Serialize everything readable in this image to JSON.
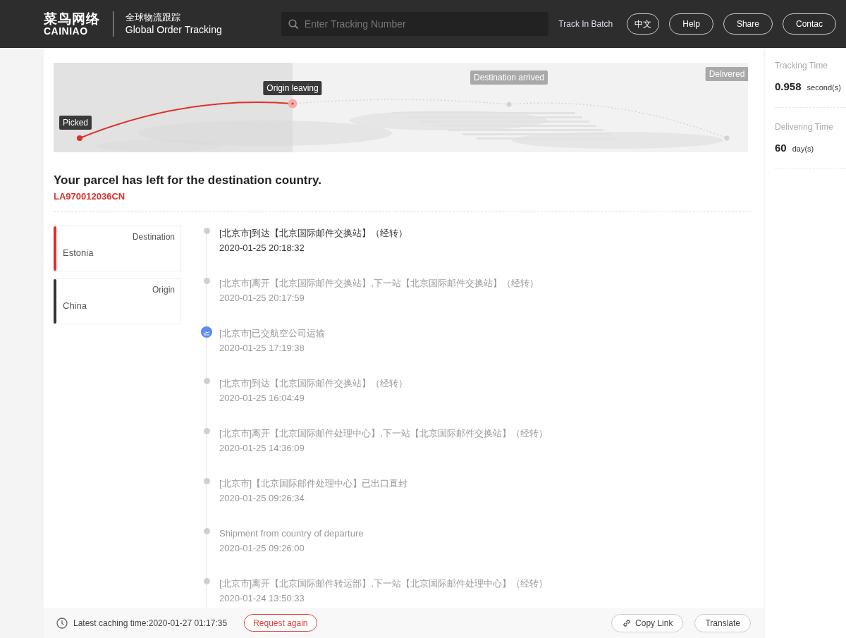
{
  "header": {
    "logo_cn": "菜鸟网络",
    "logo_en": "CAINIAO",
    "subtitle_cn": "全球物流跟踪",
    "subtitle_en": "Global Order Tracking",
    "search": {
      "placeholder": "Enter Tracking Number"
    },
    "batch_link": "Track In Batch",
    "buttons": [
      "中文",
      "Help",
      "Share",
      "Contac"
    ]
  },
  "route": {
    "milestones": [
      {
        "label": "Picked",
        "reached": true
      },
      {
        "label": "Origin leaving",
        "reached": true
      },
      {
        "label": "Destination arrived",
        "reached": false
      },
      {
        "label": "Delivered",
        "reached": false
      }
    ]
  },
  "status": {
    "title": "Your parcel has left for the destination country.",
    "tracking_number": "LA970012036CN"
  },
  "locations": [
    {
      "label": "Destination",
      "country": "Estonia",
      "color": "#e02d2d"
    },
    {
      "label": "Origin",
      "country": "China",
      "color": "#333333"
    }
  ],
  "events": [
    {
      "kind": "dot",
      "latest": true,
      "text": "[北京市]到达【北京国际邮件交换站】（经转）",
      "time": "2020-01-25 20:18:32"
    },
    {
      "kind": "dot",
      "latest": false,
      "text": "[北京市]离开【北京国际邮件交换站】,下一站【北京国际邮件交换站】（经转）",
      "time": "2020-01-25 20:17:59"
    },
    {
      "kind": "flight",
      "latest": false,
      "text": "[北京市]已交航空公司运输",
      "time": "2020-01-25 17:19:38"
    },
    {
      "kind": "dot",
      "latest": false,
      "text": "[北京市]到达【北京国际邮件交换站】（经转）",
      "time": "2020-01-25 16:04:49"
    },
    {
      "kind": "dot",
      "latest": false,
      "text": "[北京市]离开【北京国际邮件处理中心】,下一站【北京国际邮件交换站】（经转）",
      "time": "2020-01-25 14:36:09"
    },
    {
      "kind": "dot",
      "latest": false,
      "text": "[北京市]【北京国际邮件处理中心】已出口直封",
      "time": "2020-01-25 09:26:34"
    },
    {
      "kind": "dot",
      "latest": false,
      "text": "Shipment from country of departure",
      "time": "2020-01-25 09:26:00"
    },
    {
      "kind": "dot",
      "latest": false,
      "text": "[北京市]离开【北京国际邮件转运部】,下一站【北京国际邮件处理中心】（经转）",
      "time": "2020-01-24 13:50:33"
    }
  ],
  "footer": {
    "caching_text": "Latest caching time:2020-01-27 01:17:35",
    "request_button": "Request again",
    "copy_button": "Copy Link",
    "translate_button": "Translate"
  },
  "stats": [
    {
      "label": "Tracking Time",
      "value": "0.958",
      "unit": "second(s)"
    },
    {
      "label": "Delivering Time",
      "value": "60",
      "unit": "day(s)"
    }
  ]
}
